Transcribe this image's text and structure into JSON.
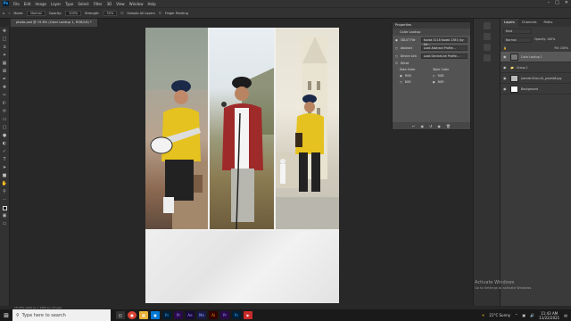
{
  "menubar": {
    "items": [
      "File",
      "Edit",
      "Image",
      "Layer",
      "Type",
      "Select",
      "Filter",
      "3D",
      "View",
      "Window",
      "Help"
    ]
  },
  "options": {
    "mode_label": "Mode:",
    "mode_value": "Normal",
    "opacity_label": "Opacity:",
    "opacity_value": "100%",
    "strength_label": "Strength:",
    "strength_value": "50%",
    "sample_all": "Sample All Layers",
    "finger": "Finger Painting"
  },
  "document": {
    "tab_title": "photo.psd @ 15.8% (Color Lookup 1, RGB/16) *",
    "status": "15.78%    1920 px x 1080 px (72 ppi)"
  },
  "properties": {
    "panel_title": "Properties",
    "sub_title": "Color Lookup",
    "file3d_label": "3DLUT File",
    "file3d_value": "Kodak 5218 Kodak 2383 (by Ad...",
    "abstract_label": "Abstract",
    "abstract_value": "Load Abstract Profile...",
    "devicelink_label": "Device Link",
    "devicelink_value": "Load DeviceLink Profile...",
    "dither_label": "Dither",
    "data_order_label": "Data Order",
    "table_order_label": "Table Order",
    "rgb": "RGB",
    "bgr": "BGR"
  },
  "layers": {
    "tabs": [
      "Layers",
      "Channels",
      "Paths"
    ],
    "kind": "Kind",
    "blend": "Normal",
    "opacity": "Opacity: 100%",
    "fill": "Fill: 100%",
    "items": [
      {
        "name": "Color Lookup 1",
        "active": true
      },
      {
        "name": "Group 1",
        "active": false
      },
      {
        "name": "Jasmiel-Khan-XL_pexels8.jpg",
        "active": false
      },
      {
        "name": "Background",
        "active": false
      }
    ]
  },
  "watermark": {
    "title": "Activate Windows",
    "sub": "Go to Settings to activate Windows."
  },
  "taskbar": {
    "search": "Type here to search",
    "weather": "21°C  Sunny",
    "time": "11:43 AM",
    "date": "11/22/2021"
  }
}
